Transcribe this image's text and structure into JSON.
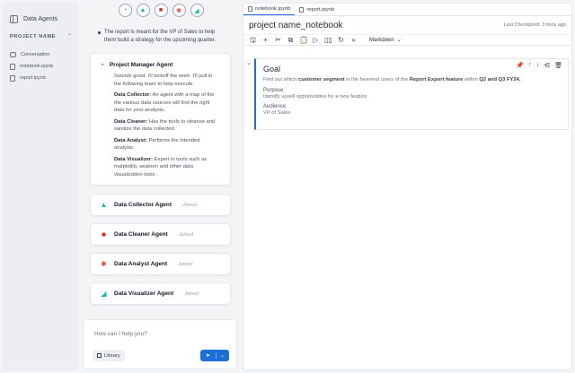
{
  "sidebar": {
    "brand": "Data Agents",
    "project_title": "PROJECT NAME",
    "files": [
      {
        "label": "Conversation",
        "icon": "chat-icon"
      },
      {
        "label": "notebook.ipynb",
        "icon": "file-icon"
      },
      {
        "label": "report.ipynb",
        "icon": "file-icon"
      }
    ]
  },
  "chat": {
    "avatars": [
      "project-manager-agent-avatar",
      "data-collector-agent-avatar",
      "data-cleaner-agent-avatar",
      "data-analyst-agent-avatar",
      "data-visualizer-agent-avatar"
    ],
    "intro_bullet": "The report is meant for the VP of Sales to help them build a strategy for the upcoming quarter.",
    "pm_card": {
      "name": "Project Manager Agent",
      "message": "Sounds good. I'll kickoff the work. I'll pull in the following team to help execute.",
      "roles": [
        {
          "title": "Data Collector:",
          "desc": " An agent with a map of the the various data sources will find the right data for your analysis."
        },
        {
          "title": "Data Cleaner:",
          "desc": " Has the tools to cleanse and sanitize the data collected."
        },
        {
          "title": "Data Analyst:",
          "desc": " Performs the intended analysis."
        },
        {
          "title": "Data Visualizer:",
          "desc": " Expert in tools such as matplotlib, seaborn and other data visualization tools ."
        }
      ]
    },
    "agents": [
      {
        "name": "Data Collector Agent",
        "status": "Joined",
        "glyph": "▲",
        "color": "#10b981"
      },
      {
        "name": "Data Cleaner Agent",
        "status": "Joined",
        "glyph": "■",
        "color": "#dc2626"
      },
      {
        "name": "Data Analyst Agent",
        "status": "Joined",
        "glyph": "✱",
        "color": "#ef4444"
      },
      {
        "name": "Data Visualizer Agent",
        "status": "Joined",
        "glyph": "◢",
        "color": "#14b8a6"
      }
    ],
    "input_placeholder": "How can I help you?",
    "library_label": "Library"
  },
  "notebook": {
    "tabs": [
      "notebook.ipynb",
      "report.ipynb"
    ],
    "title": "project name_notebook",
    "checkpoint": "Last Checkpoint: 3 mins ago",
    "mode": "Markdown",
    "cell": {
      "heading": "Goal",
      "goal_pre": "Find out which ",
      "goal_b1": "customer segment",
      "goal_mid": " is the heaviest users of the ",
      "goal_b2": "Report Export feature",
      "goal_mid2": " within ",
      "goal_b3": "Q2 and Q3 FY24.",
      "purpose_label": "Purpose",
      "purpose_text": "Identify upsell opportunities for a new feature.",
      "audience_label": "Audience",
      "audience_text": "VP of Sales"
    }
  },
  "colors": {
    "accent": "#1d6fd8"
  }
}
